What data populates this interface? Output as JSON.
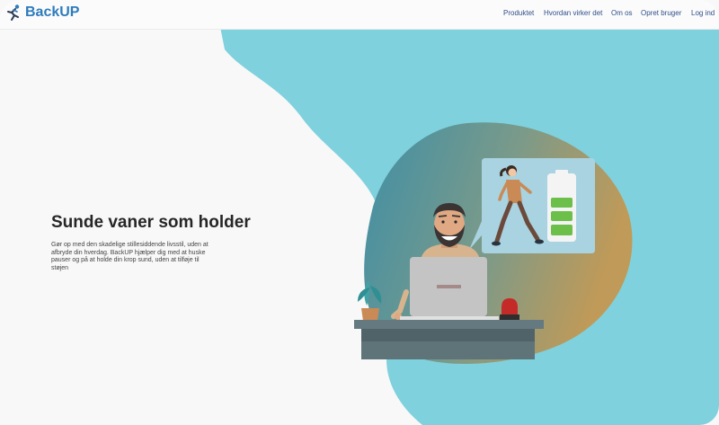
{
  "header": {
    "brand": "BackUP",
    "nav": [
      "Produktet",
      "Hvordan virker det",
      "Om os",
      "Opret bruger",
      "Log ind"
    ]
  },
  "hero": {
    "title": "Sunde vaner som holder",
    "text": "Gør op med den skadelige stillesiddende livsstil, uden at afbryde din hverdag. BackUP hjælper dig med at huske pauser og på at holde din krop sund, uden at tilføje til støjen"
  },
  "icons": [
    "runner-logo-icon",
    "potted-plant-icon",
    "alarm-light-icon",
    "battery-icon"
  ],
  "colors": {
    "brand": "#2d7bbd",
    "blob": "#7fd1dd",
    "nav": "#2f4f8a",
    "battery_green": "#6cc04a"
  },
  "battery": {
    "level": 0.6
  }
}
